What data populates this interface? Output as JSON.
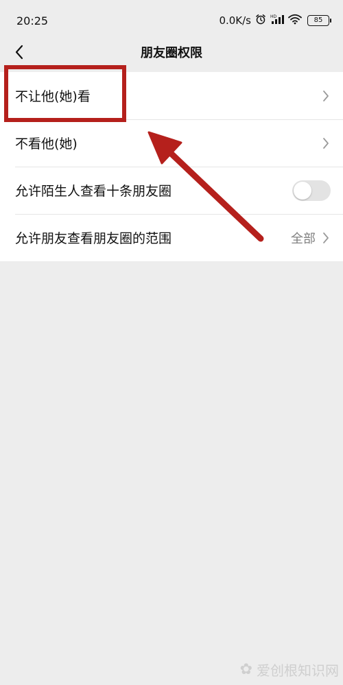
{
  "status_bar": {
    "time": "20:25",
    "network_speed": "0.0K/s",
    "battery": "85",
    "icons": [
      "alarm-icon",
      "hd-signal-icon",
      "wifi-icon",
      "battery-icon"
    ]
  },
  "nav": {
    "title": "朋友圈权限",
    "back_icon": "chevron-left-icon"
  },
  "settings": {
    "items": [
      {
        "label": "不让他(她)看",
        "control": "chevron"
      },
      {
        "label": "不看他(她)",
        "control": "chevron"
      },
      {
        "label": "允许陌生人查看十条朋友圈",
        "control": "toggle",
        "toggle_on": false
      },
      {
        "label": "允许朋友查看朋友圈的范围",
        "value": "全部",
        "control": "chevron"
      }
    ]
  },
  "annotation": {
    "color": "#b5201c"
  },
  "colors": {
    "background": "#ededed",
    "list_background": "#ffffff",
    "secondary_text": "#808080"
  }
}
